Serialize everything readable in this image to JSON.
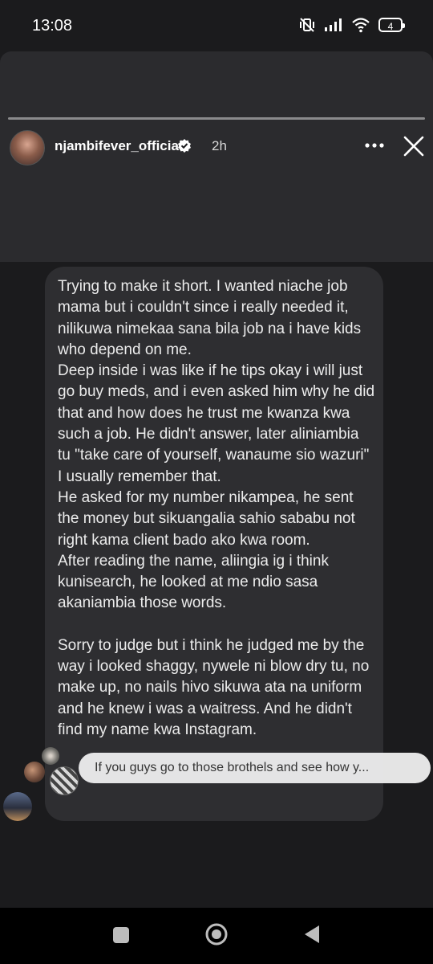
{
  "status_bar": {
    "time": "13:08",
    "battery": "4",
    "icons": [
      "mute-vibrate-icon",
      "signal-icon",
      "wifi-icon",
      "battery-icon"
    ]
  },
  "story": {
    "username": "njambifever_official",
    "age": "2h",
    "icons": [
      "verified-badge-icon",
      "more-options-icon",
      "close-icon"
    ]
  },
  "post": {
    "paragraphs": [
      "Trying to make it short. I wanted niache job mama but i couldn't since i really needed it, nilikuwa nimekaa sana bila job na i have kids who depend on me.",
      "Deep inside i was like if he tips okay i will just go buy meds, and i even asked him why he did that and how does he trust me kwanza kwa such a job. He didn't answer, later aliniambia tu \"take care of yourself, wanaume sio wazuri\" I usually remember that.",
      "He asked for my number nikampea, he sent the money but sikuangalia sahio sababu not right kama client bado ako kwa room.",
      "After reading the name, aliingia ig i think kunisearch, he looked at me ndio sasa akaniambia those words.",
      "",
      "Sorry to judge but i think he judged me by the way i looked shaggy, nywele ni blow dry tu, no make up, no nails hivo sikuwa ata na uniform and he knew i was a waitress. And he didn't find my name kwa Instagram."
    ]
  },
  "comment_overlay": {
    "text": "If you guys go to those brothels and see how y..."
  },
  "nav_bar": {
    "icons": [
      "recent-apps-icon",
      "home-icon",
      "back-icon"
    ]
  },
  "colors": {
    "background": "#1b1b1d",
    "story_header": "#2b2b2e",
    "bubble": "#2e2e31",
    "verified": "#ffffff",
    "comment_pill": "#ececec"
  }
}
